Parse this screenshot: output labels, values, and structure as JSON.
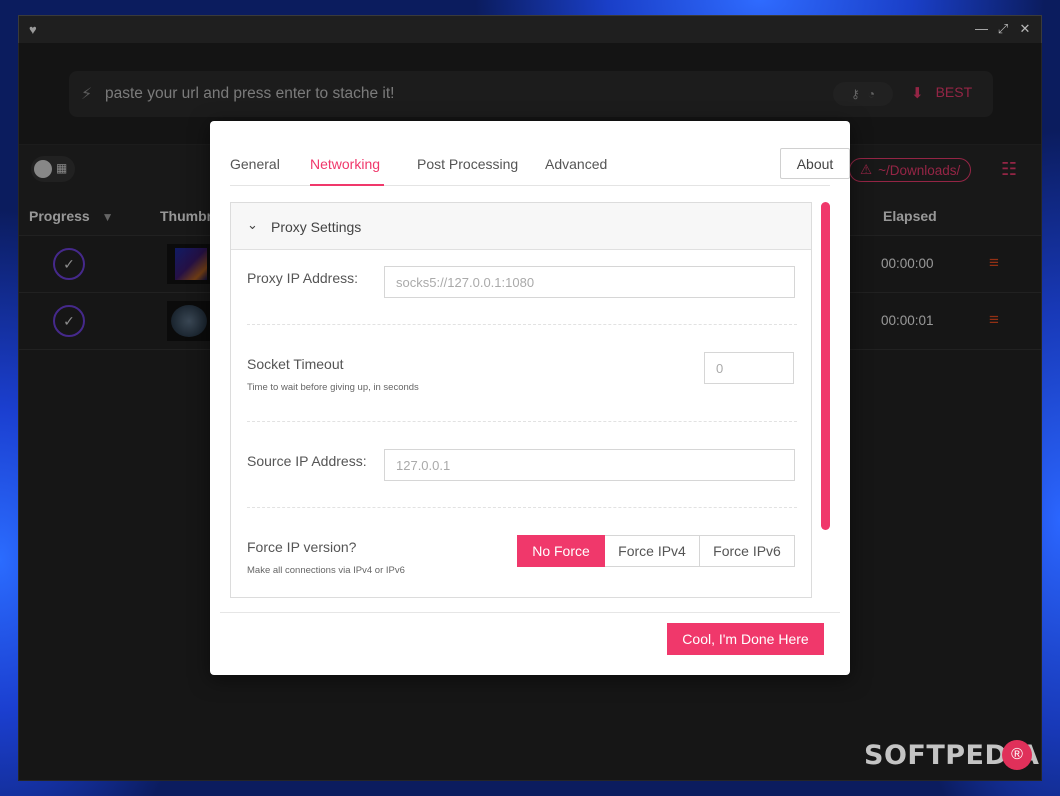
{
  "window": {
    "heart": "♥",
    "minimize": "—",
    "maximize": "⤢",
    "close": "✕"
  },
  "url_bar": {
    "bolt_icon": "⚡",
    "placeholder": "paste your url and press enter to stache it!",
    "key_icon": "⚷",
    "cookie_icon": "◔",
    "download_icon": "⬇",
    "quality": "BEST"
  },
  "toolbar": {
    "grid_icon": "▦",
    "warning_icon": "⚠",
    "download_path": "~/Downloads/",
    "settings_icon": "☷"
  },
  "table": {
    "headers": {
      "progress": "Progress",
      "filter_icon": "▼",
      "thumbnail": "Thumbnail",
      "elapsed": "Elapsed"
    },
    "rows": [
      {
        "check": "✓",
        "elapsed": "00:00:00",
        "menu": "≡"
      },
      {
        "check": "✓",
        "elapsed": "00:00:01",
        "menu": "≡"
      }
    ]
  },
  "dialog": {
    "tabs": [
      "General",
      "Networking",
      "Post Processing",
      "Advanced"
    ],
    "active_tab": "Networking",
    "about": "About",
    "section": {
      "chevron": "⌄",
      "title": "Proxy Settings"
    },
    "fields": {
      "proxy": {
        "label": "Proxy IP Address:",
        "placeholder": "socks5://127.0.0.1:1080"
      },
      "timeout": {
        "label": "Socket Timeout",
        "desc": "Time to wait before giving up, in seconds",
        "placeholder": "0"
      },
      "source": {
        "label": "Source IP Address:",
        "placeholder": "127.0.0.1"
      },
      "force": {
        "label": "Force IP version?",
        "desc": "Make all connections via IPv4 or IPv6",
        "options": [
          "No Force",
          "Force IPv4",
          "Force IPv6"
        ],
        "selected": "No Force"
      }
    },
    "done": "Cool, I'm Done Here"
  },
  "watermark": {
    "text": "SOFTPEDIA",
    "mark": "®"
  },
  "colors": {
    "accent": "#f0386b",
    "app_bg": "#222222",
    "progress_ring": "#6b3fd6",
    "menu_orange": "#e04a20"
  }
}
